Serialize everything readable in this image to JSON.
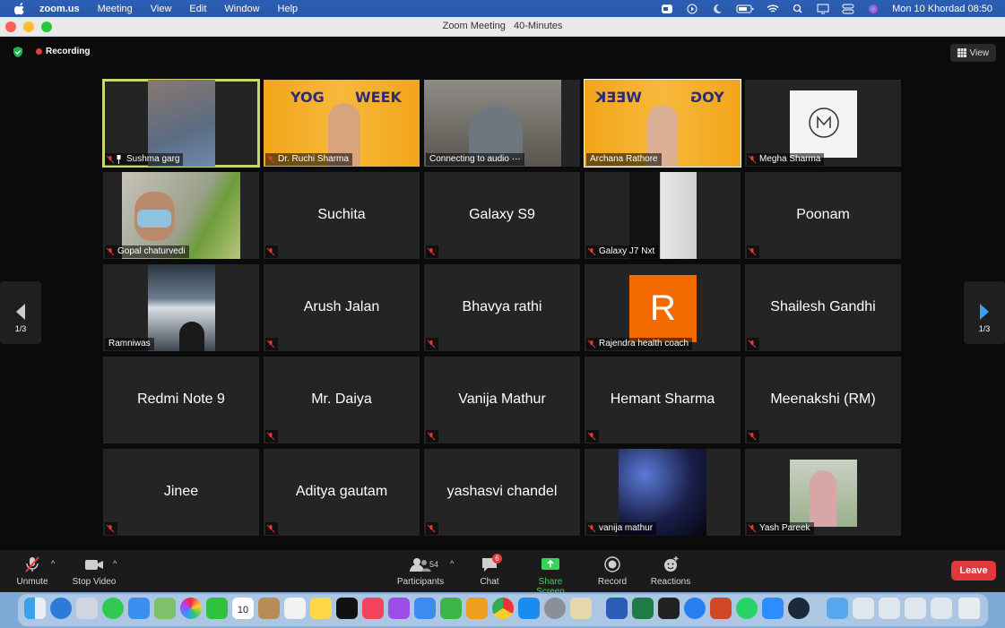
{
  "menubar": {
    "app_name": "zoom.us",
    "menus": [
      "Meeting",
      "View",
      "Edit",
      "Window",
      "Help"
    ],
    "clock": "Mon 10 Khordad  08:50"
  },
  "window": {
    "title": "Zoom Meeting",
    "subtitle": "40-Minutes"
  },
  "meeting": {
    "recording_label": "Recording",
    "view_label": "View",
    "page_indicator_left": "1/3",
    "page_indicator_right": "1/3"
  },
  "tiles": [
    {
      "name": "Sushma garg",
      "video": true,
      "active": true,
      "pinned": true
    },
    {
      "name": "Dr. Ruchi Sharma",
      "video": true
    },
    {
      "name": "Connecting to audio ···",
      "video": true
    },
    {
      "name": "Archana Rathore",
      "video": true
    },
    {
      "name": "Megha Sharma",
      "video": true
    },
    {
      "name": "Gopal chaturvedi",
      "video": true
    },
    {
      "name": "Suchita",
      "video": false
    },
    {
      "name": "Galaxy S9",
      "video": false
    },
    {
      "name": "Galaxy J7 Nxt",
      "video": true
    },
    {
      "name": "Poonam",
      "video": false
    },
    {
      "name": "Ramniwas",
      "video": true
    },
    {
      "name": "Arush  Jalan",
      "video": false
    },
    {
      "name": "Bhavya rathi",
      "video": false
    },
    {
      "name": "Rajendra health coach",
      "video": true,
      "avatar_letter": "R"
    },
    {
      "name": "Shailesh Gandhi",
      "video": false
    },
    {
      "name": "Redmi Note 9",
      "video": false
    },
    {
      "name": "Mr. Daiya",
      "video": false
    },
    {
      "name": "Vanija Mathur",
      "video": false
    },
    {
      "name": "Hemant Sharma",
      "video": false
    },
    {
      "name": "Meenakshi (RM)",
      "video": false
    },
    {
      "name": "Jinee",
      "video": false
    },
    {
      "name": "Aditya gautam",
      "video": false
    },
    {
      "name": "yashasvi  chandel",
      "video": false
    },
    {
      "name": "vanija mathur",
      "video": true
    },
    {
      "name": "Yash Pareek",
      "video": true
    }
  ],
  "banners": {
    "yog": "YOG",
    "week": "WEEK",
    "yog_mirrored": "YOG",
    "week_mirrored": "WEEK"
  },
  "toolbar": {
    "unmute_label": "Unmute",
    "stop_video_label": "Stop Video",
    "participants_label": "Participants",
    "participants_count": "54",
    "chat_label": "Chat",
    "chat_badge": "6",
    "share_label": "Share Screen",
    "record_label": "Record",
    "reactions_label": "Reactions",
    "leave_label": "Leave"
  },
  "dock": {
    "calendar_day": "10"
  },
  "colors": {
    "accent_green": "#3ad35a",
    "leave_red": "#e0383b",
    "active_speaker": "#c7d96e",
    "avatar_orange": "#f26a00"
  }
}
